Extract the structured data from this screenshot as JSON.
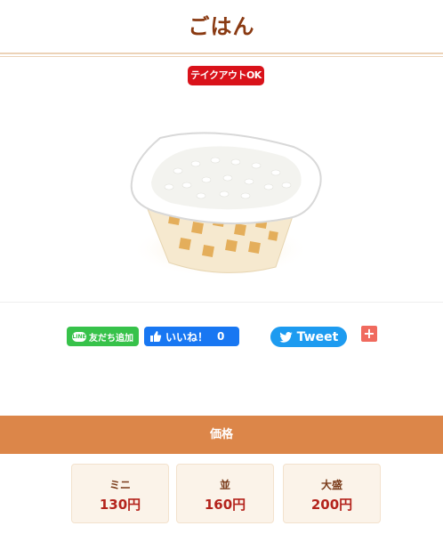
{
  "page": {
    "title": "ごはん",
    "takeout_badge": "テイクアウトOK"
  },
  "share": {
    "line_badge": "LINE",
    "line_label": "友だち追加",
    "facebook_label": "いいね！",
    "facebook_count": "0",
    "twitter_label": "Tweet",
    "plus_label": "+"
  },
  "pricing": {
    "header": "価格",
    "options": [
      {
        "size": "ミニ",
        "price": "130円"
      },
      {
        "size": "並",
        "price": "160円"
      },
      {
        "size": "大盛",
        "price": "200円"
      }
    ]
  },
  "colors": {
    "title": "#8a3a12",
    "takeout": "#d9121a",
    "line": "#37c24a",
    "facebook": "#1877f2",
    "twitter": "#1d9bf0",
    "price_bar": "#dc8649",
    "price_text": "#b4231c"
  }
}
